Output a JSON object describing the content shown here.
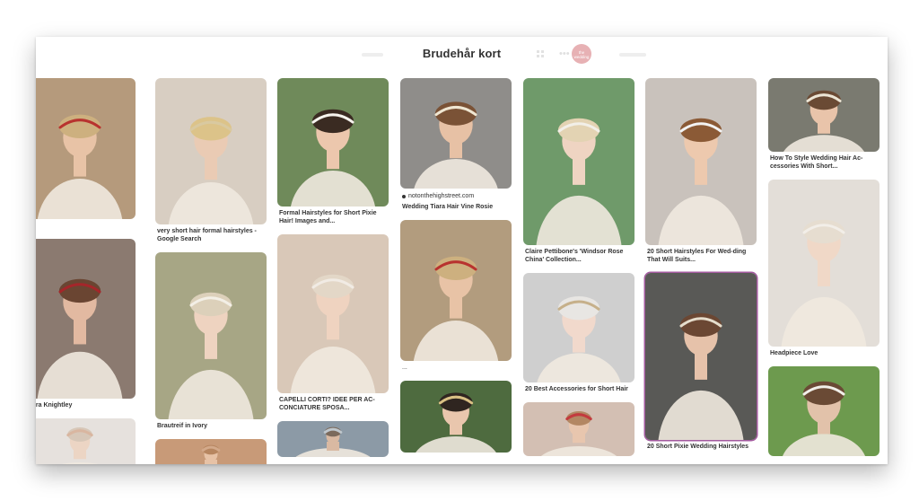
{
  "board": {
    "title": "Brudehår kort"
  },
  "header": {
    "avatar_text": "the wedding",
    "more_icon": "ellipsis-icon",
    "grid_icon": "grid-icon"
  },
  "columns": [
    {
      "pins": [
        {
          "caption": "",
          "source": "",
          "ellipsis": "...",
          "h": 157,
          "bg": "#b59a7c",
          "accent": "#b8332f",
          "hair": "#cdb07f",
          "skin": "#e8c3a6"
        },
        {
          "caption": "Keira Knightley",
          "source": "",
          "h": 178,
          "bg": "#8b7a70",
          "accent": "#a5262a",
          "hair": "#6a4532",
          "skin": "#e2b9a1"
        },
        {
          "caption": "",
          "source": "",
          "h": 60,
          "bg": "#e6e1dd",
          "accent": "#d9b6a0",
          "hair": "#d7c7b8",
          "skin": "#ecd5c4"
        }
      ]
    },
    {
      "pins": [
        {
          "caption": "very short hair formal hairstyles - Google Search",
          "source": "",
          "h": 163,
          "bg": "#d8cec2",
          "accent": "#d9c9a0",
          "hair": "#dcc389",
          "skin": "#eacbb4"
        },
        {
          "caption": "Brautreif in Ivory",
          "source": "",
          "h": 186,
          "bg": "#a7a685",
          "accent": "#f3efe6",
          "hair": "#dcd0ba",
          "skin": "#eed3c0"
        },
        {
          "caption": "",
          "source": "",
          "h": 40,
          "bg": "#c89a78",
          "accent": "#d3a98a",
          "hair": "#b78660",
          "skin": "#e7c2a6"
        }
      ]
    },
    {
      "pins": [
        {
          "caption": "Formal Hairstyles for Short Pixie Hair! Images and...",
          "source": "",
          "h": 143,
          "bg": "#6f8a5a",
          "accent": "#f6f4ee",
          "hair": "#3a2b22",
          "skin": "#ecc7ad"
        },
        {
          "caption": "CAPELLI CORTI? IDEE PER AC-CONCIATURE SPOSA...",
          "source": "",
          "h": 177,
          "bg": "#d9c8b8",
          "accent": "#f1ebe4",
          "hair": "#e3d7c7",
          "skin": "#efd3c0"
        },
        {
          "caption": "",
          "source": "",
          "h": 40,
          "bg": "#8c9aa6",
          "accent": "#bfc7cd",
          "hair": "#7b6a5c",
          "skin": "#d9b9a2"
        }
      ]
    },
    {
      "pins": [
        {
          "caption": "Wedding Tiara Hair Vine Rosie",
          "source": "notonthehighstreet.com",
          "h": 123,
          "bg": "#8f8d8a",
          "accent": "#efe6d2",
          "hair": "#7a5236",
          "skin": "#e7c1a5"
        },
        {
          "caption": "",
          "source": "",
          "ellipsis": "...",
          "h": 157,
          "bg": "#b29c7e",
          "accent": "#b8332f",
          "hair": "#cdb07f",
          "skin": "#e8c3a6"
        },
        {
          "caption": "",
          "source": "",
          "h": 80,
          "bg": "#4e6b3f",
          "accent": "#d9c084",
          "hair": "#2f2520",
          "skin": "#e9c6ad"
        }
      ]
    },
    {
      "pins": [
        {
          "caption": "Claire Pettibone's 'Windsor Rose China' Collection...",
          "source": "",
          "h": 186,
          "bg": "#6f9a6a",
          "accent": "#f2efe8",
          "hair": "#e3d3b3",
          "skin": "#efd4c2"
        },
        {
          "caption": "20 Best Accessories for Short Hair",
          "source": "",
          "h": 122,
          "bg": "#cfcfcf",
          "accent": "#c6b08a",
          "hair": "#e8e6e3",
          "skin": "#f1d9cc"
        },
        {
          "caption": "",
          "source": "",
          "h": 60,
          "bg": "#d3bfb3",
          "accent": "#c33a3e",
          "hair": "#b38763",
          "skin": "#e8c6ae"
        }
      ]
    },
    {
      "pins": [
        {
          "caption": "20 Short Hairstyles For Wed-ding That Will Suits...",
          "source": "",
          "h": 186,
          "bg": "#c9c2bc",
          "accent": "#f3f3f3",
          "hair": "#8b5a36",
          "skin": "#edc9ae"
        },
        {
          "caption": "20 Short Pixie Wedding Hairstyles",
          "source": "",
          "h": 186,
          "bg": "#595956",
          "accent": "#e6ddcc",
          "hair": "#6b4733",
          "skin": "#e6c2aa",
          "highlight": true
        }
      ]
    },
    {
      "pins": [
        {
          "caption": "How To Style Wedding Hair Ac-cessories With Short...",
          "source": "",
          "h": 82,
          "bg": "#7a7a70",
          "accent": "#ece5d5",
          "hair": "#6a4a34",
          "skin": "#e9c4aa"
        },
        {
          "caption": "Headpiece Love",
          "source": "",
          "h": 186,
          "bg": "#e3ded8",
          "accent": "#f2eee8",
          "hair": "#e6ddd0",
          "skin": "#f0d8c7"
        },
        {
          "caption": "",
          "source": "",
          "h": 100,
          "bg": "#6d9a4e",
          "accent": "#f1efe9",
          "hair": "#6a4a35",
          "skin": "#e2c2aa"
        }
      ]
    }
  ],
  "colors": {
    "highlight": "#a35a9f",
    "text": "#333333",
    "avatar": "#e7b1b4"
  }
}
